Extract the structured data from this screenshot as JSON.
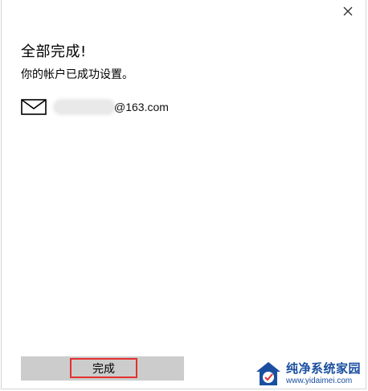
{
  "dialog": {
    "title": "全部完成!",
    "subtitle": "你的帐户已成功设置。",
    "account": {
      "email_suffix": "@163.com",
      "icon": "mail-icon"
    },
    "done_label": "完成",
    "close_icon": "close-icon"
  },
  "watermark": {
    "name": "纯净系统家园",
    "url": "www.yidaimei.com"
  },
  "colors": {
    "done_bar": "#cccccc",
    "highlight_border": "#e3302f",
    "watermark": "#1a4fa0"
  }
}
